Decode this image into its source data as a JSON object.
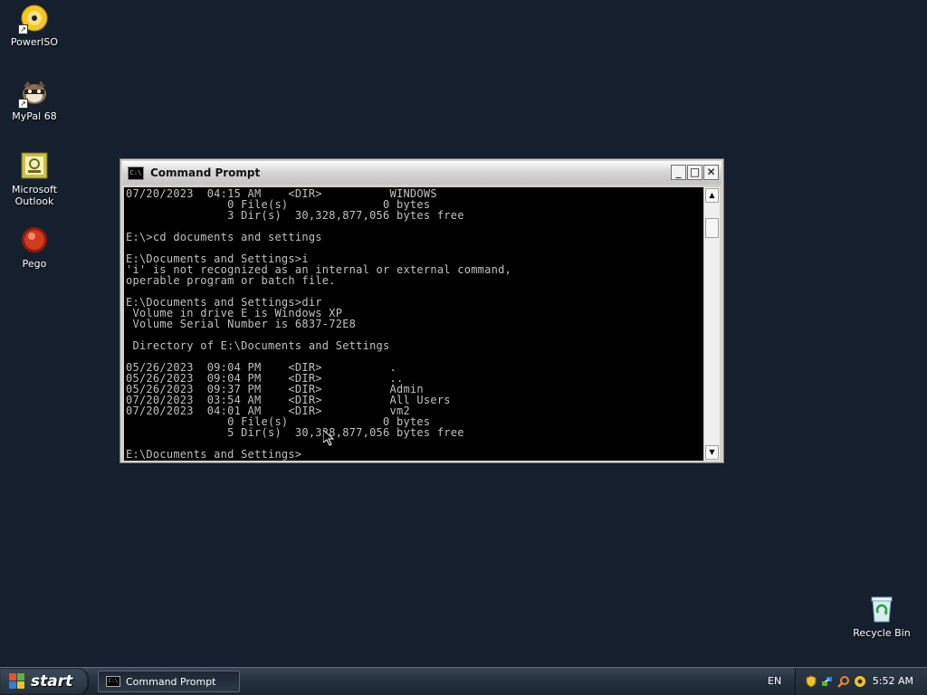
{
  "desktop": {
    "icons": [
      {
        "label": "PowerISO",
        "icon": "poweriso-disc-icon"
      },
      {
        "label": "MyPal 68",
        "icon": "mypal-raccoon-icon"
      },
      {
        "label": "Microsoft\nOutlook",
        "icon": "outlook-icon"
      },
      {
        "label": "Pego",
        "icon": "pego-icon"
      },
      {
        "label": "Recycle Bin",
        "icon": "recycle-bin-icon"
      }
    ]
  },
  "window": {
    "title": "Command Prompt",
    "title_icon": "C:\\",
    "console_lines": [
      "07/20/2023  04:15 AM    <DIR>          WINDOWS",
      "               0 File(s)              0 bytes",
      "               3 Dir(s)  30,328,877,056 bytes free",
      "",
      "E:\\>cd documents and settings",
      "",
      "E:\\Documents and Settings>i",
      "'i' is not recognized as an internal or external command,",
      "operable program or batch file.",
      "",
      "E:\\Documents and Settings>dir",
      " Volume in drive E is Windows XP",
      " Volume Serial Number is 6837-72E8",
      "",
      " Directory of E:\\Documents and Settings",
      "",
      "05/26/2023  09:04 PM    <DIR>          .",
      "05/26/2023  09:04 PM    <DIR>          ..",
      "05/26/2023  09:37 PM    <DIR>          Admin",
      "07/20/2023  03:54 AM    <DIR>          All Users",
      "07/20/2023  04:01 AM    <DIR>          vm2",
      "               0 File(s)              0 bytes",
      "               5 Dir(s)  30,328,877,056 bytes free",
      "",
      "E:\\Documents and Settings>"
    ],
    "buttons": {
      "minimize": "_",
      "maximize": "□",
      "close": "✕"
    }
  },
  "taskbar": {
    "start_label": "start",
    "task_button_label": "Command Prompt",
    "language": "EN",
    "clock": "5:52 AM"
  },
  "colors": {
    "desktop_bg": "#151f2d",
    "console_bg": "#000000",
    "console_fg": "#c0c0c0"
  }
}
